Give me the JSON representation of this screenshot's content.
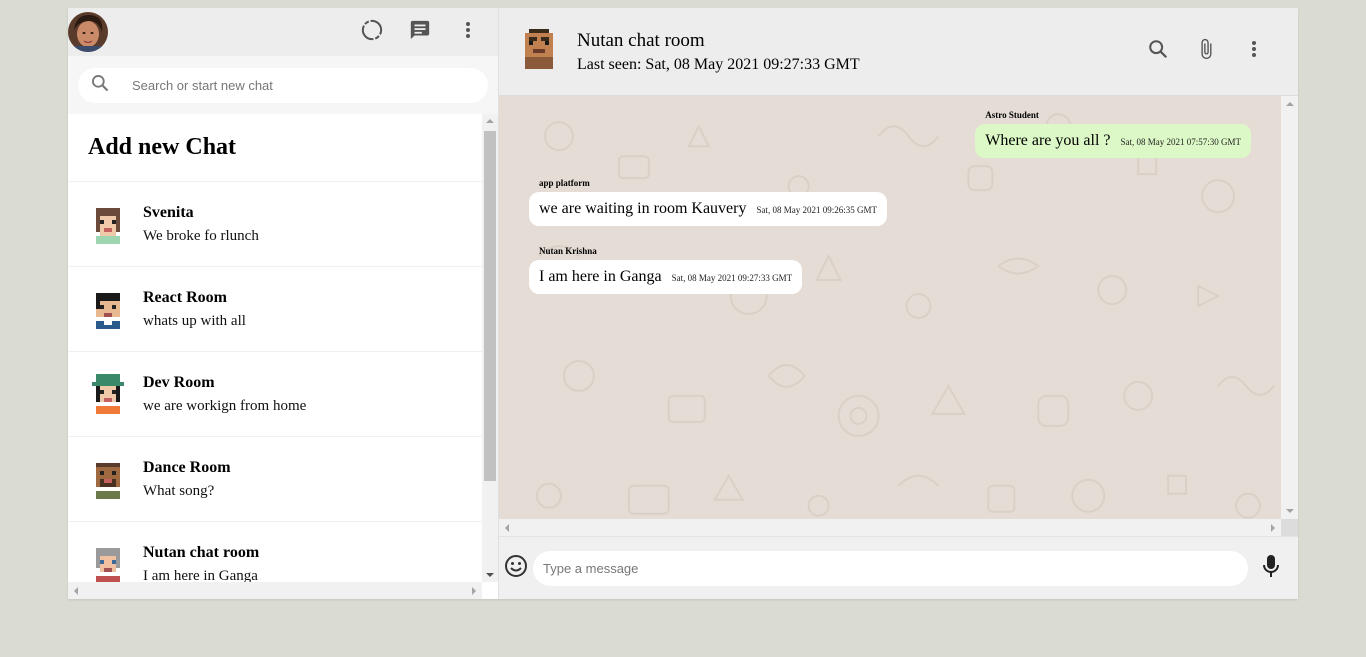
{
  "sidebar": {
    "search": {
      "placeholder": "Search or start new chat"
    },
    "add_chat_label": "Add new Chat",
    "chats": [
      {
        "name": "Svenita",
        "last": "We broke fo rlunch",
        "avatar": "svenita-avatar"
      },
      {
        "name": "React Room",
        "last": "whats up with all",
        "avatar": "react-room-avatar"
      },
      {
        "name": "Dev Room",
        "last": "we are workign from home",
        "avatar": "dev-room-avatar"
      },
      {
        "name": "Dance Room",
        "last": "What song?",
        "avatar": "dance-room-avatar"
      },
      {
        "name": "Nutan chat room",
        "last": "I am here in Ganga",
        "avatar": "nutan-room-avatar"
      }
    ],
    "icons": [
      "status-icon",
      "new-chat-icon",
      "menu-dots-icon"
    ]
  },
  "chat": {
    "title": "Nutan chat room",
    "last_seen": "Last seen: Sat, 08 May 2021 09:27:33 GMT",
    "messages": [
      {
        "sender": "Astro Student",
        "text": "Where are you all ?",
        "time": "Sat, 08 May 2021 07:57:30 GMT",
        "sent": true
      },
      {
        "sender": "app platform",
        "text": "we are waiting in room Kauvery",
        "time": "Sat, 08 May 2021 09:26:35 GMT",
        "sent": false
      },
      {
        "sender": "Nutan Krishna",
        "text": "I am here in Ganga",
        "time": "Sat, 08 May 2021 09:27:33 GMT",
        "sent": false
      }
    ],
    "footer": {
      "placeholder": "Type a message"
    }
  },
  "colors": {
    "background": "#dadbd3",
    "header": "#ededed",
    "sent_bubble": "#dcf8c6",
    "received_bubble": "#ffffff",
    "chat_bg": "#e5ddd5"
  }
}
